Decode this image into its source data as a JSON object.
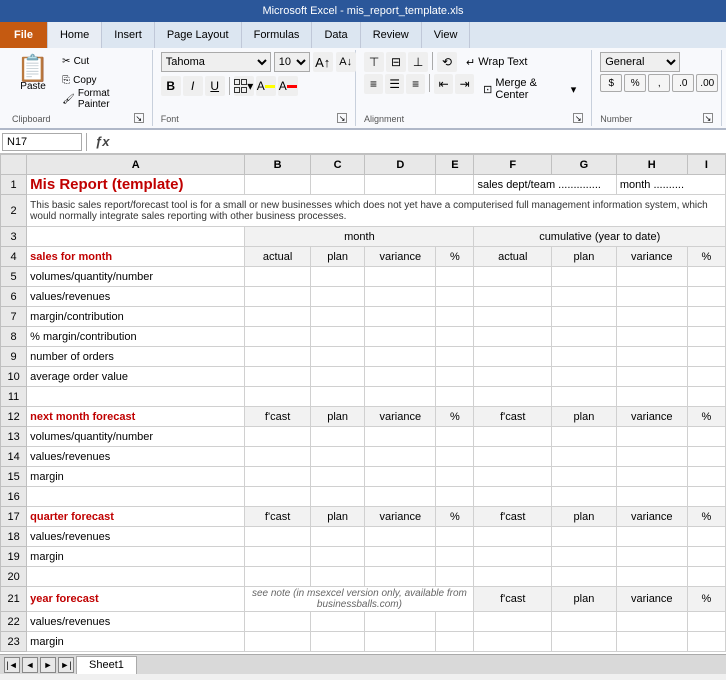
{
  "titleBar": {
    "text": "Microsoft Excel - mis_report_template.xls"
  },
  "ribbon": {
    "tabs": [
      "File",
      "Home",
      "Insert",
      "Page Layout",
      "Formulas",
      "Data",
      "Review",
      "View"
    ],
    "activeTab": "Home",
    "fileTab": "File"
  },
  "clipboard": {
    "paste": "Paste",
    "cut": "Cut",
    "copy": "Copy",
    "formatPainter": "Format Painter",
    "groupLabel": "Clipboard"
  },
  "font": {
    "name": "Tahoma",
    "size": "10",
    "bold": "B",
    "italic": "I",
    "underline": "U",
    "increaseFont": "A",
    "decreaseFont": "A",
    "groupLabel": "Font"
  },
  "alignment": {
    "wrapText": "Wrap Text",
    "mergeCenter": "Merge & Center",
    "groupLabel": "Alignment"
  },
  "number": {
    "format": "General",
    "currency": "$",
    "percent": "%",
    "comma": ",",
    "increaseDecimal": ".0",
    "decreaseDecimal": ".00",
    "groupLabel": "Number"
  },
  "formulaBar": {
    "cellRef": "N17",
    "fx": "ƒx",
    "formula": ""
  },
  "columns": [
    "",
    "A",
    "B",
    "C",
    "D",
    "E",
    "F",
    "G",
    "H",
    "I"
  ],
  "rows": [
    {
      "num": "1",
      "cells": {
        "A": {
          "text": "Mis Report (template)",
          "class": "red-title"
        },
        "F": {
          "text": "sales dept/team  .............."
        },
        "H": {
          "text": "month  .........."
        }
      }
    },
    {
      "num": "2",
      "cells": {
        "A": {
          "text": "This basic sales report/forecast tool is for a small or new businesses which does not yet have a computerised full management information system, which would normally integrate sales reporting with other business processes.",
          "class": "merged-info",
          "colspan": 9
        }
      }
    },
    {
      "num": "3",
      "cells": {
        "B": {
          "text": "month",
          "class": "center header-gray",
          "colspan": 4
        },
        "F": {
          "text": "cumulative (year to date)",
          "class": "center header-gray",
          "colspan": 4
        }
      }
    },
    {
      "num": "4",
      "cells": {
        "A": {
          "text": "sales for month",
          "class": "red-bold"
        },
        "B": {
          "text": "actual",
          "class": "center header-gray"
        },
        "C": {
          "text": "plan",
          "class": "center header-gray"
        },
        "D": {
          "text": "variance",
          "class": "center header-gray"
        },
        "E": {
          "text": "%",
          "class": "center header-gray"
        },
        "F": {
          "text": "actual",
          "class": "center header-gray"
        },
        "G": {
          "text": "plan",
          "class": "center header-gray"
        },
        "H": {
          "text": "variance",
          "class": "center header-gray"
        },
        "I": {
          "text": "%",
          "class": "center header-gray"
        }
      }
    },
    {
      "num": "5",
      "cells": {
        "A": {
          "text": "volumes/quantity/number"
        }
      }
    },
    {
      "num": "6",
      "cells": {
        "A": {
          "text": "values/revenues"
        }
      }
    },
    {
      "num": "7",
      "cells": {
        "A": {
          "text": "margin/contribution"
        }
      }
    },
    {
      "num": "8",
      "cells": {
        "A": {
          "text": "% margin/contribution"
        }
      }
    },
    {
      "num": "9",
      "cells": {
        "A": {
          "text": "number of orders"
        }
      }
    },
    {
      "num": "10",
      "cells": {
        "A": {
          "text": "average order value"
        }
      }
    },
    {
      "num": "11",
      "cells": {}
    },
    {
      "num": "12",
      "cells": {
        "A": {
          "text": "next month forecast",
          "class": "red-bold"
        },
        "B": {
          "text": "f'cast",
          "class": "center header-gray"
        },
        "C": {
          "text": "plan",
          "class": "center header-gray"
        },
        "D": {
          "text": "variance",
          "class": "center header-gray"
        },
        "E": {
          "text": "%",
          "class": "center header-gray"
        },
        "F": {
          "text": "f'cast",
          "class": "center header-gray"
        },
        "G": {
          "text": "plan",
          "class": "center header-gray"
        },
        "H": {
          "text": "variance",
          "class": "center header-gray"
        },
        "I": {
          "text": "%",
          "class": "center header-gray"
        }
      }
    },
    {
      "num": "13",
      "cells": {
        "A": {
          "text": "volumes/quantity/number"
        }
      }
    },
    {
      "num": "14",
      "cells": {
        "A": {
          "text": "values/revenues"
        }
      }
    },
    {
      "num": "15",
      "cells": {
        "A": {
          "text": "margin"
        }
      }
    },
    {
      "num": "16",
      "cells": {}
    },
    {
      "num": "17",
      "cells": {
        "A": {
          "text": "quarter forecast",
          "class": "red-bold"
        },
        "B": {
          "text": "f'cast",
          "class": "center header-gray"
        },
        "C": {
          "text": "plan",
          "class": "center header-gray"
        },
        "D": {
          "text": "variance",
          "class": "center header-gray"
        },
        "E": {
          "text": "%",
          "class": "center header-gray"
        },
        "F": {
          "text": "f'cast",
          "class": "center header-gray"
        },
        "G": {
          "text": "plan",
          "class": "center header-gray"
        },
        "H": {
          "text": "variance",
          "class": "center header-gray"
        },
        "I": {
          "text": "%",
          "class": "center header-gray"
        }
      }
    },
    {
      "num": "18",
      "cells": {
        "A": {
          "text": "values/revenues"
        }
      }
    },
    {
      "num": "19",
      "cells": {
        "A": {
          "text": "margin"
        }
      }
    },
    {
      "num": "20",
      "cells": {}
    },
    {
      "num": "21",
      "cells": {
        "A": {
          "text": "year forecast",
          "class": "red-bold"
        },
        "B": {
          "text": "see note (in msexcel version only, available from businessballs.com)",
          "class": "center italic-note",
          "colspan": 4
        },
        "F": {
          "text": "f'cast",
          "class": "center header-gray"
        },
        "G": {
          "text": "plan",
          "class": "center header-gray"
        },
        "H": {
          "text": "variance",
          "class": "center header-gray"
        },
        "I": {
          "text": "%",
          "class": "center header-gray"
        }
      }
    },
    {
      "num": "22",
      "cells": {
        "A": {
          "text": "values/revenues"
        }
      }
    },
    {
      "num": "23",
      "cells": {
        "A": {
          "text": "margin"
        }
      }
    }
  ],
  "sheetTabs": {
    "sheets": [
      "Sheet1"
    ],
    "active": "Sheet1"
  }
}
